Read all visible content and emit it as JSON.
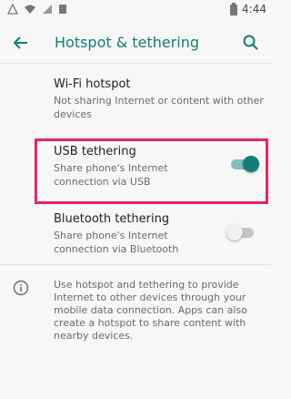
{
  "status_bar": {
    "time": "4:44"
  },
  "app_bar": {
    "title": "Hotspot & tethering"
  },
  "settings": {
    "wifi_hotspot": {
      "title": "Wi-Fi hotspot",
      "subtitle": "Not sharing Internet or content with other devices"
    },
    "usb_tethering": {
      "title": "USB tethering",
      "subtitle": "Share phone's Internet connection via USB",
      "enabled": true
    },
    "bluetooth_tethering": {
      "title": "Bluetooth tethering",
      "subtitle": "Share phone's Internet connection via Bluetooth",
      "enabled": false
    }
  },
  "footer": {
    "info_text": "Use hotspot and tethering to provide Internet to other devices through your mobile data connection. Apps can also create a hotspot to share content with nearby devices."
  },
  "colors": {
    "accent": "#0f7f73",
    "highlight": "#e8245f",
    "background": "#f7f7f7"
  },
  "icons": [
    "back-arrow-icon",
    "search-icon",
    "info-icon",
    "wifi-icon",
    "notification-icon",
    "sim-icon",
    "signal-icon",
    "battery-icon"
  ]
}
